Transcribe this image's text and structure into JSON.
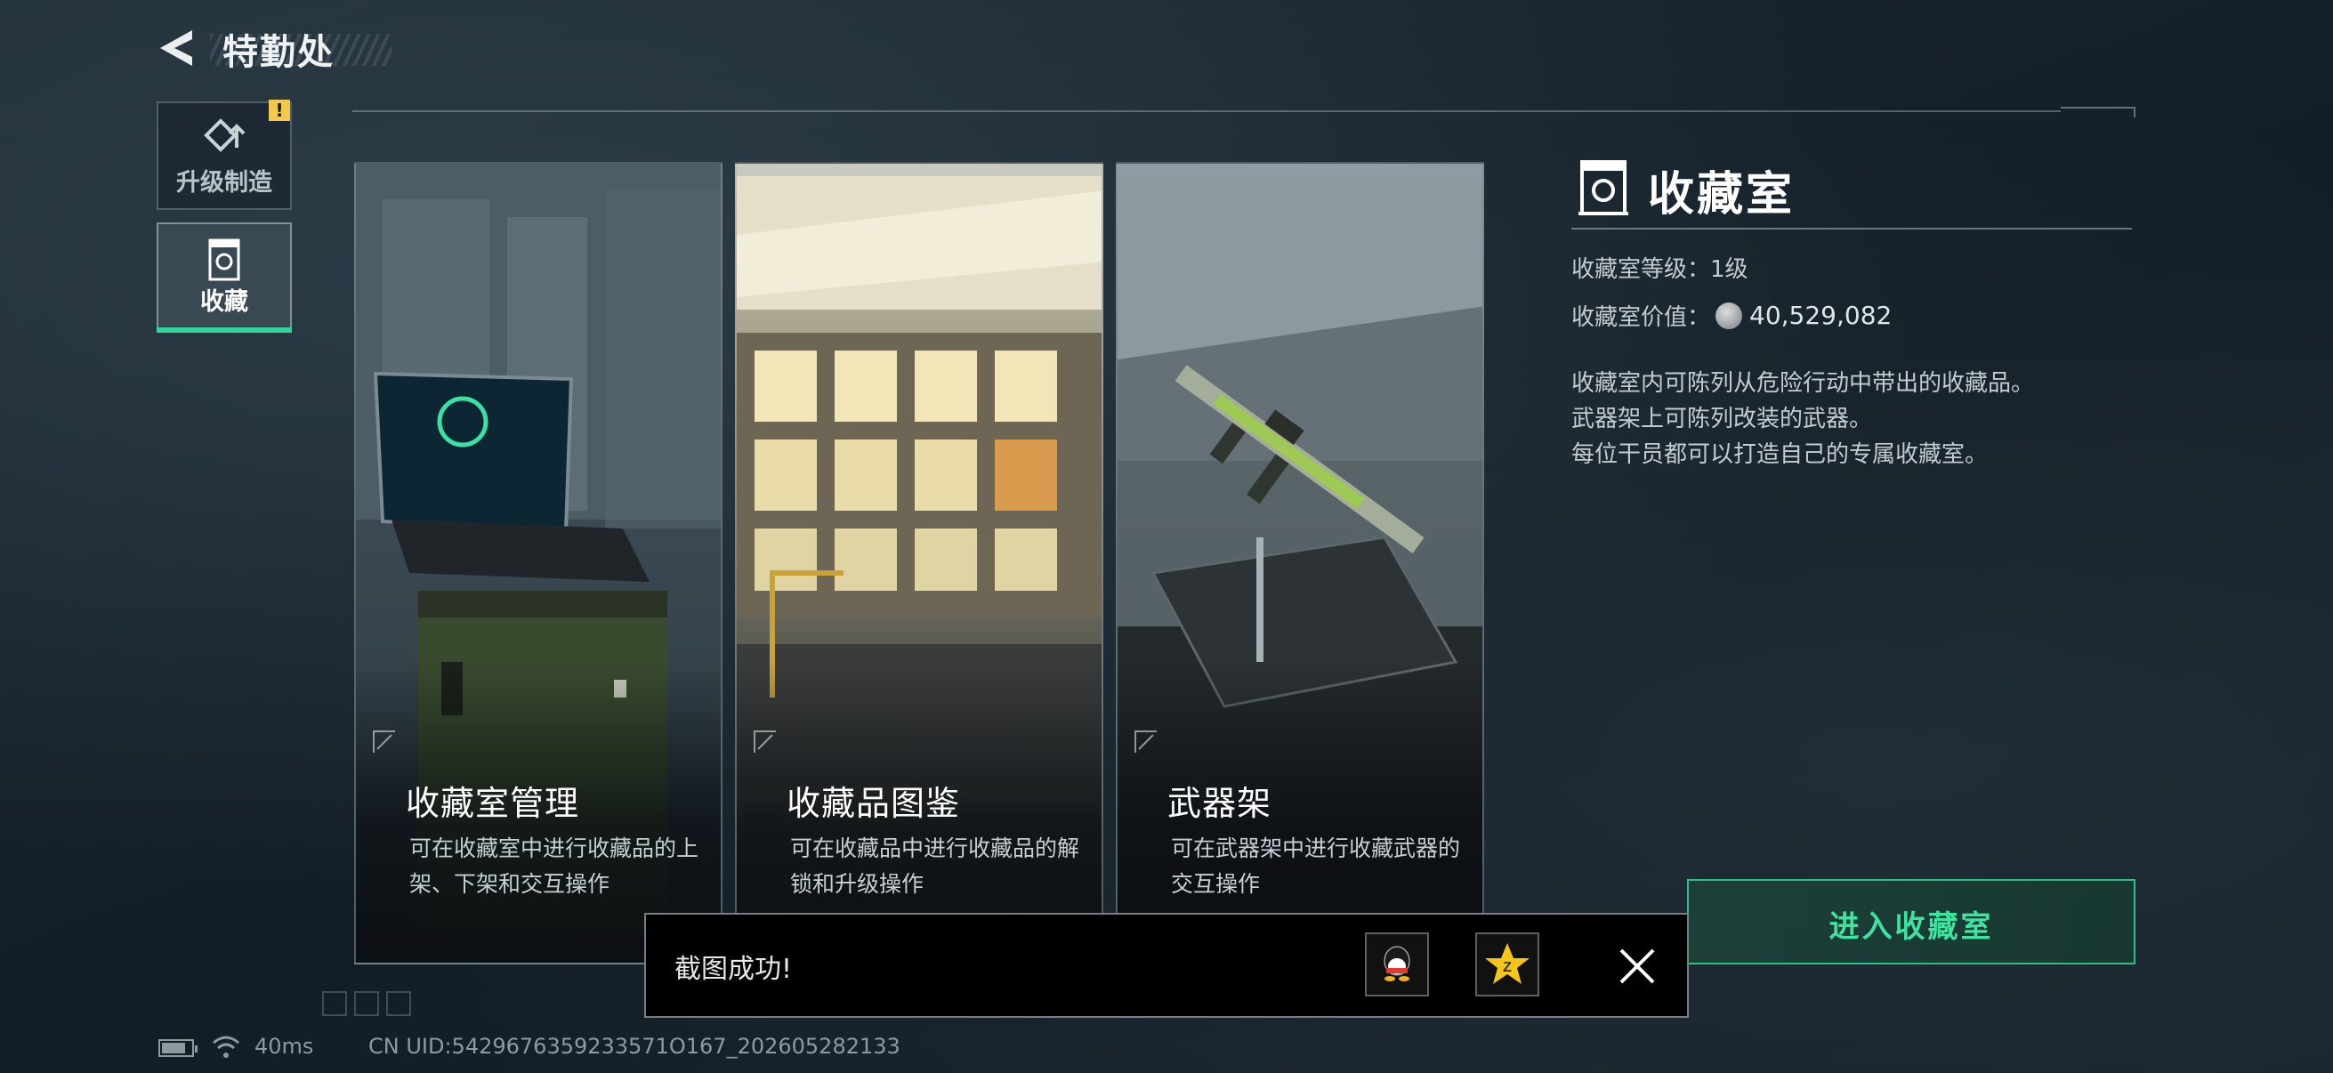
{
  "header": {
    "title": "特勤处"
  },
  "sidebar": {
    "items": [
      {
        "label": "升级制造",
        "icon": "upgrade-craft-icon",
        "alert": "!"
      },
      {
        "label": "收藏",
        "icon": "collection-cabinet-icon"
      }
    ]
  },
  "cards": [
    {
      "title": "收藏室管理",
      "desc": "可在收藏室中进行收藏品的上架、下架和交互操作"
    },
    {
      "title": "收藏品图鉴",
      "desc": "可在收藏品中进行收藏品的解锁和升级操作"
    },
    {
      "title": "武器架",
      "desc": "可在武器架中进行收藏武器的交互操作"
    }
  ],
  "panel": {
    "title": "收藏室",
    "level_label": "收藏室等级：",
    "level_value": "1级",
    "value_label": "收藏室价值：",
    "value_amount": "40,529,082",
    "description": [
      "收藏室内可陈列从危险行动中带出的收藏品。",
      "武器架上可陈列改装的武器。",
      "每位干员都可以打造自己的专属收藏室。"
    ],
    "enter_label": "进入收藏室"
  },
  "toast": {
    "message": "截图成功!",
    "share_icons": [
      "qq-icon",
      "qzone-icon"
    ],
    "close_icon": "close-icon"
  },
  "status_bar": {
    "ping": "40ms",
    "uid": "CN UID:5429676359233571O167_202605282133"
  },
  "colors": {
    "accent_green": "#34d39a",
    "alert_yellow": "#f2c94c",
    "background": "#17222b"
  }
}
